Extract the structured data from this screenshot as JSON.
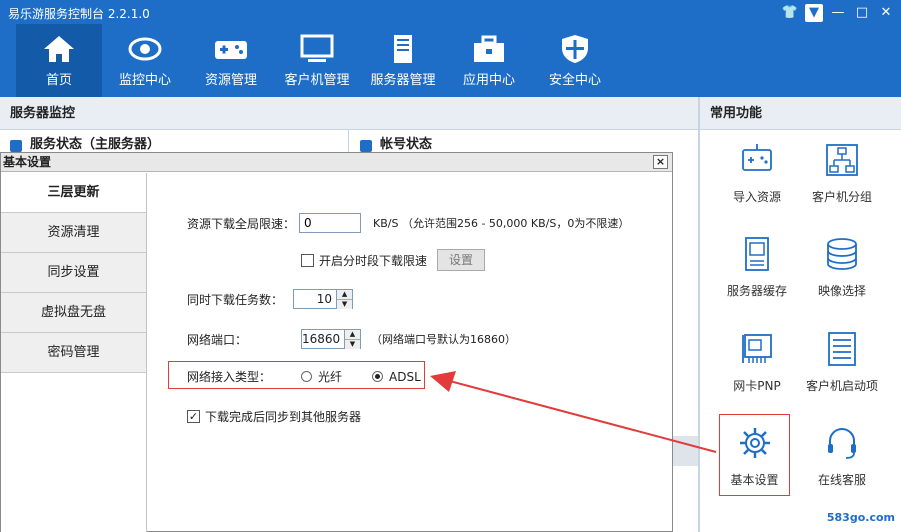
{
  "app": {
    "title": "易乐游服务控制台 2.2.1.0"
  },
  "window_controls": [
    "shirt-icon",
    "dropdown-icon",
    "minimize-icon",
    "maximize-icon",
    "close-icon"
  ],
  "nav": [
    {
      "label": "首页",
      "icon": "home-icon",
      "active": true
    },
    {
      "label": "监控中心",
      "icon": "eye-icon"
    },
    {
      "label": "资源管理",
      "icon": "gamepad-icon"
    },
    {
      "label": "客户机管理",
      "icon": "monitor-icon"
    },
    {
      "label": "服务器管理",
      "icon": "server-icon"
    },
    {
      "label": "应用中心",
      "icon": "toolbox-icon"
    },
    {
      "label": "安全中心",
      "icon": "shield-icon"
    }
  ],
  "main": {
    "panel_title": "服务器监控",
    "status_a": "服务状态（主服务器）",
    "status_b": "帐号状态"
  },
  "functions": {
    "title": "常用功能",
    "items": [
      {
        "label": "导入资源",
        "icon": "import-icon"
      },
      {
        "label": "客户机分组",
        "icon": "group-icon"
      },
      {
        "label": "服务器缓存",
        "icon": "cache-icon"
      },
      {
        "label": "映像选择",
        "icon": "disk-stack-icon"
      },
      {
        "label": "网卡PNP",
        "icon": "nic-icon"
      },
      {
        "label": "客户机启动项",
        "icon": "list-icon"
      },
      {
        "label": "基本设置",
        "icon": "gear-icon"
      },
      {
        "label": "在线客服",
        "icon": "headset-icon"
      }
    ],
    "watermark": "583go.com"
  },
  "dialog": {
    "title": "基本设置",
    "close": "×",
    "side_items": [
      "三层更新",
      "资源清理",
      "同步设置",
      "虚拟盘无盘",
      "密码管理"
    ],
    "form": {
      "speed_label": "资源下载全局限速：",
      "speed_value": "0",
      "speed_hint": "KB/S （允许范围256 - 50,000 KB/S，0为不限速）",
      "timed_limit_label": "开启分时段下载限速",
      "set_button": "设置",
      "tasks_label": "同时下载任务数：",
      "tasks_value": "10",
      "port_label": "网络端口：",
      "port_value": "16860",
      "port_hint": "（网络端口号默认为16860）",
      "net_type_label": "网络接入类型：",
      "net_option_1": "光纤",
      "net_option_2": "ADSL",
      "net_selected": "ADSL",
      "sync_label": "下载完成后同步到其他服务器",
      "sync_checked": true
    }
  },
  "colors": {
    "brand": "#1e6ec7",
    "highlight": "#e23b3b"
  }
}
